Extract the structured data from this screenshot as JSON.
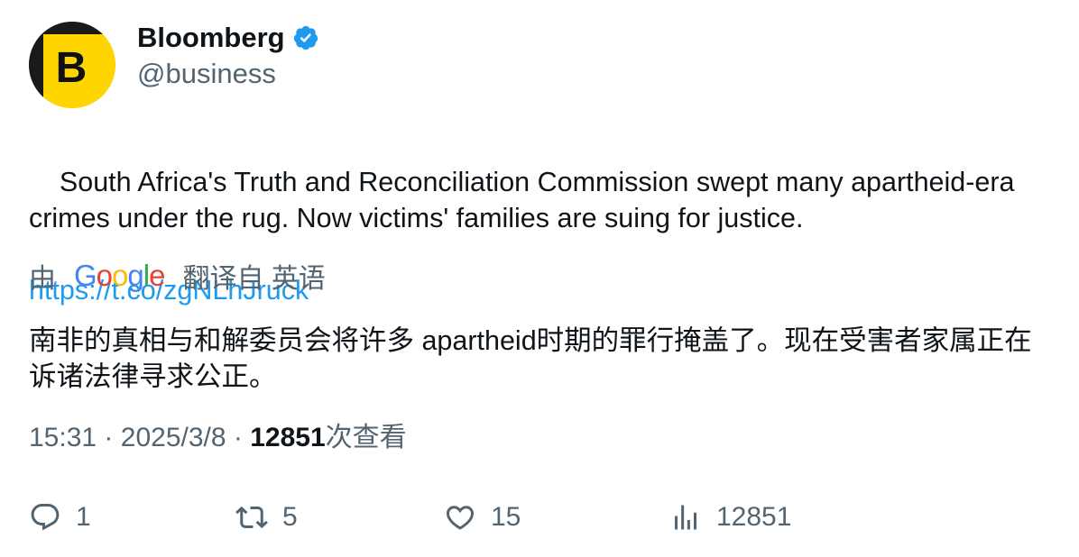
{
  "author": {
    "display_name": "Bloomberg",
    "handle": "@business",
    "avatar_letter": "B",
    "verified": true
  },
  "tweet": {
    "text": "South Africa's Truth and Reconciliation Commission swept many apartheid-era crimes under the rug. Now victims' families are suing for justice.",
    "link": "https://t.co/zgNLhJruck"
  },
  "translation": {
    "by_label": "由",
    "provider": "Google",
    "from_label": "翻译自 英语",
    "text": "南非的真相与和解委员会将许多 apartheid时期的罪行掩盖了。现在受害者家属正在诉诸法律寻求公正。"
  },
  "meta": {
    "time": "15:31",
    "separator": "·",
    "date": "2025/3/8",
    "views_count": "12851",
    "views_label": "次查看"
  },
  "actions": {
    "replies": "1",
    "retweets": "5",
    "likes": "15",
    "views": "12851"
  },
  "colors": {
    "text_primary": "#0f1419",
    "text_secondary": "#536471",
    "link": "#1d9bf0",
    "verified": "#1d9bf0",
    "avatar_bg": "#ffd500"
  },
  "icons": {
    "verified": "verified-badge-icon",
    "reply": "reply-icon",
    "retweet": "retweet-icon",
    "like": "heart-icon",
    "views": "views-chart-icon"
  }
}
